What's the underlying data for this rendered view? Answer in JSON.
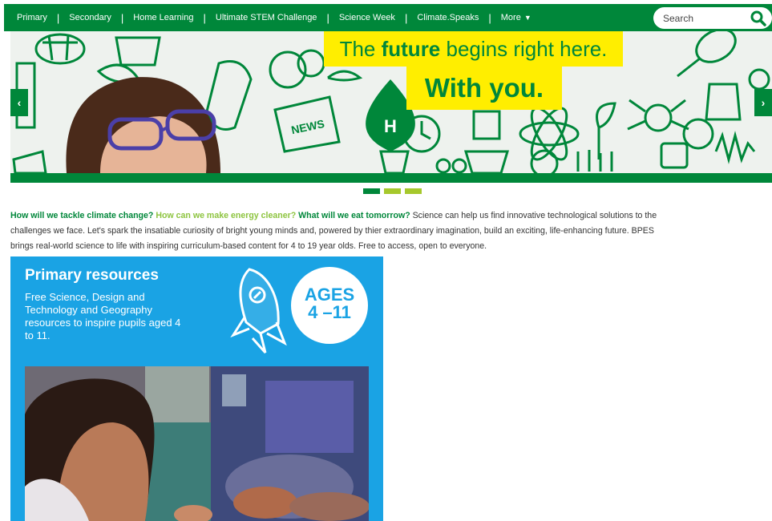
{
  "nav": {
    "items": [
      "Primary",
      "Secondary",
      "Home Learning",
      "Ultimate STEM Challenge",
      "Science Week",
      "Climate.Speaks",
      "More"
    ],
    "separator": "|",
    "more_arrow": "▼",
    "search_placeholder": "Search"
  },
  "hero": {
    "tagline_pre": "The ",
    "tagline_bold": "future",
    "tagline_post": " begins right here.",
    "tagline2": "With you.",
    "doodle_text": "NEWS",
    "prev_arrow": "‹",
    "next_arrow": "›",
    "slide_count": 3,
    "active_slide": 1
  },
  "intro": {
    "q1": "How will we tackle climate change?",
    "q2": "How can we make energy cleaner?",
    "q3": "What will we eat tomorrow?",
    "line1_rest": " Science can help us find innovative technological solutions to the",
    "line2": "challenges we face. Let's spark the insatiable curiosity of bright young minds and, powered by thier extraordinary imagination, build an exciting, life-enhancing future. BPES",
    "line3": "brings real-world science to life with inspiring curriculum-based content for 4 to 19 year olds. Free to access, open to everyone."
  },
  "card": {
    "title": "Primary resources",
    "description": "Free Science, Design and Technology and Geography resources to inspire pupils aged 4 to 11.",
    "ages_label": "AGES",
    "ages_range": "4 –11"
  },
  "colors": {
    "brand_green": "#00873a",
    "light_green": "#8dc43f",
    "yellow": "#ffee00",
    "card_blue": "#1aa3e4"
  }
}
